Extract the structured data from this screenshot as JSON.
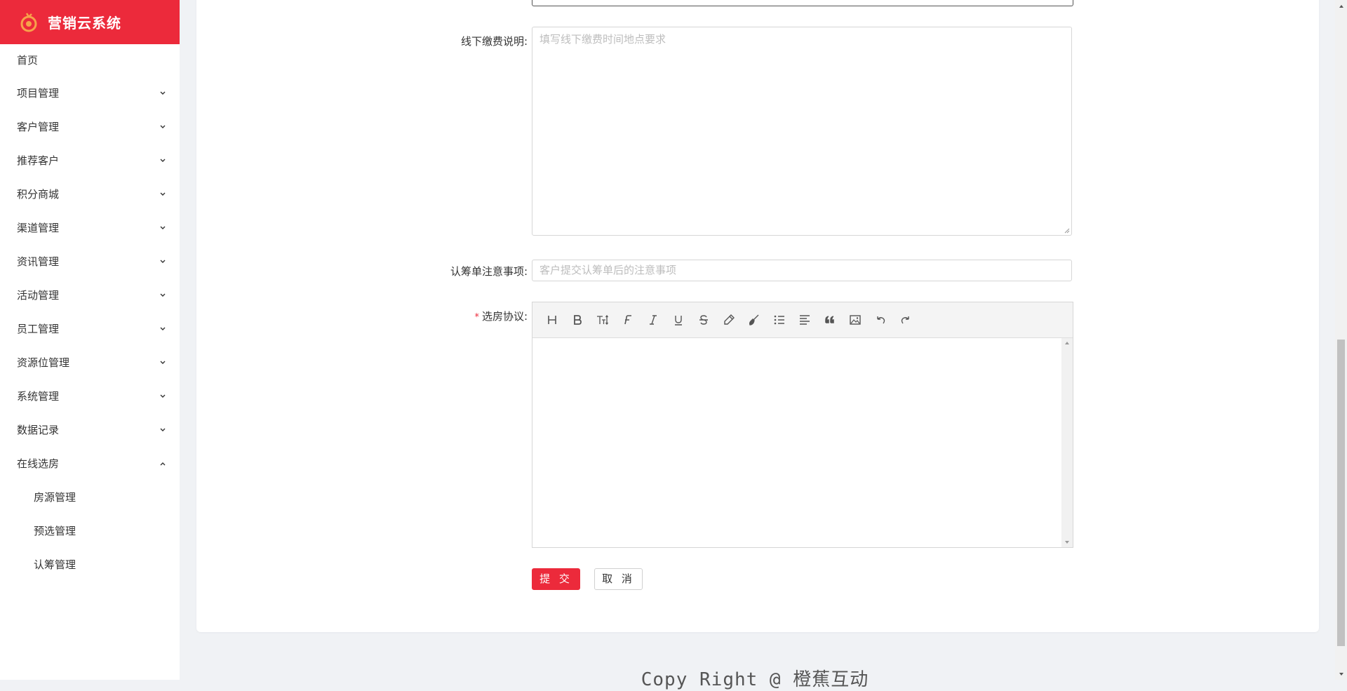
{
  "brand": {
    "name": "营销云系统",
    "accent": "#ec2a3b"
  },
  "sidebar": {
    "items": [
      {
        "label": "首页",
        "icon": "none"
      },
      {
        "label": "项目管理",
        "icon": "chevron-down-icon"
      },
      {
        "label": "客户管理",
        "icon": "chevron-down-icon"
      },
      {
        "label": "推荐客户",
        "icon": "chevron-down-icon"
      },
      {
        "label": "积分商城",
        "icon": "chevron-down-icon"
      },
      {
        "label": "渠道管理",
        "icon": "chevron-down-icon"
      },
      {
        "label": "资讯管理",
        "icon": "chevron-down-icon"
      },
      {
        "label": "活动管理",
        "icon": "chevron-down-icon"
      },
      {
        "label": "员工管理",
        "icon": "chevron-down-icon"
      },
      {
        "label": "资源位管理",
        "icon": "chevron-down-icon"
      },
      {
        "label": "系统管理",
        "icon": "chevron-down-icon"
      },
      {
        "label": "数据记录",
        "icon": "chevron-down-icon"
      },
      {
        "label": "在线选房",
        "icon": "chevron-up-icon",
        "expanded": true
      }
    ],
    "subitems": [
      {
        "label": "房源管理"
      },
      {
        "label": "预选管理"
      },
      {
        "label": "认筹管理"
      }
    ]
  },
  "form": {
    "offline_payment": {
      "label": "线下缴费说明:",
      "placeholder": "填写线下缴费时间地点要求"
    },
    "subscription_notes": {
      "label": "认筹单注意事项:",
      "placeholder": "客户提交认筹单后的注意事项"
    },
    "agreement": {
      "required_mark": "*",
      "label": "选房协议:"
    },
    "toolbar_icons": [
      "heading-icon",
      "bold-icon",
      "font-size-icon",
      "font-family-icon",
      "italic-icon",
      "underline-icon",
      "strikethrough-icon",
      "highlight-pen-icon",
      "format-brush-icon",
      "bullet-list-icon",
      "align-icon",
      "quote-icon",
      "image-icon",
      "undo-icon",
      "redo-icon"
    ],
    "submit_label": "提 交",
    "cancel_label": "取 消"
  },
  "footer": {
    "text": "Copy Right @ 橙蕉互动"
  }
}
